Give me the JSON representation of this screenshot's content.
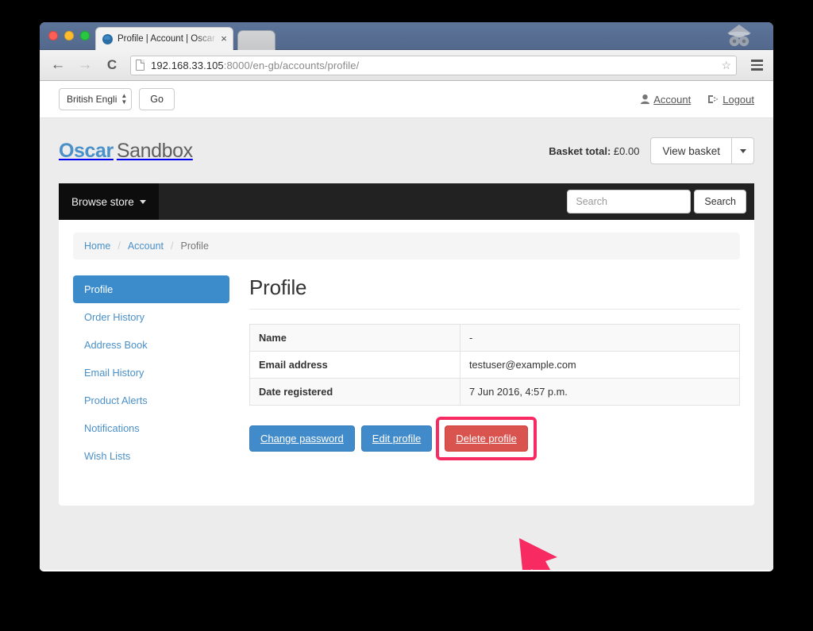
{
  "browser": {
    "tab_title": "Profile | Account | Oscar - S",
    "tab_close_glyph": "×",
    "url_host": "192.168.33.105",
    "url_path": ":8000/en-gb/accounts/profile/",
    "back_glyph": "←",
    "forward_glyph": "→",
    "reload_glyph": "C",
    "star_glyph": "☆",
    "icons": {
      "favicon": "oscar-favicon",
      "incognito": "incognito-icon",
      "menu": "hamburger-menu-icon",
      "page": "page-document-icon"
    }
  },
  "topbar": {
    "language_value": "British Engli",
    "go_label": "Go",
    "account_label": "Account",
    "logout_label": "Logout"
  },
  "branding": {
    "logo_primary": "Oscar",
    "logo_secondary": "Sandbox",
    "basket_total_label": "Basket total:",
    "basket_total_value": "£0.00",
    "view_basket_label": "View basket"
  },
  "navbar": {
    "browse_store_label": "Browse store",
    "search_placeholder": "Search",
    "search_value": "",
    "search_button_label": "Search"
  },
  "breadcrumb": {
    "home": "Home",
    "account": "Account",
    "current": "Profile",
    "separator": "/"
  },
  "sidebar": {
    "items": [
      {
        "label": "Profile",
        "active": true
      },
      {
        "label": "Order History",
        "active": false
      },
      {
        "label": "Address Book",
        "active": false
      },
      {
        "label": "Email History",
        "active": false
      },
      {
        "label": "Product Alerts",
        "active": false
      },
      {
        "label": "Notifications",
        "active": false
      },
      {
        "label": "Wish Lists",
        "active": false
      }
    ]
  },
  "main": {
    "page_title": "Profile",
    "table": {
      "rows": [
        {
          "label": "Name",
          "value": "-"
        },
        {
          "label": "Email address",
          "value": "testuser@example.com"
        },
        {
          "label": "Date registered",
          "value": "7 Jun 2016, 4:57 p.m."
        }
      ]
    },
    "buttons": {
      "change_password": "Change password",
      "edit_profile": "Edit profile",
      "delete_profile": "Delete profile"
    }
  },
  "annotation": {
    "highlight_color": "#f72a62",
    "target": "delete-profile-button"
  },
  "colors": {
    "brand_blue": "#4a90c9",
    "button_primary": "#428bca",
    "button_danger": "#d9534f",
    "navbar_dark": "#222222",
    "page_background": "#ececec",
    "highlight_pink": "#f72a62"
  }
}
